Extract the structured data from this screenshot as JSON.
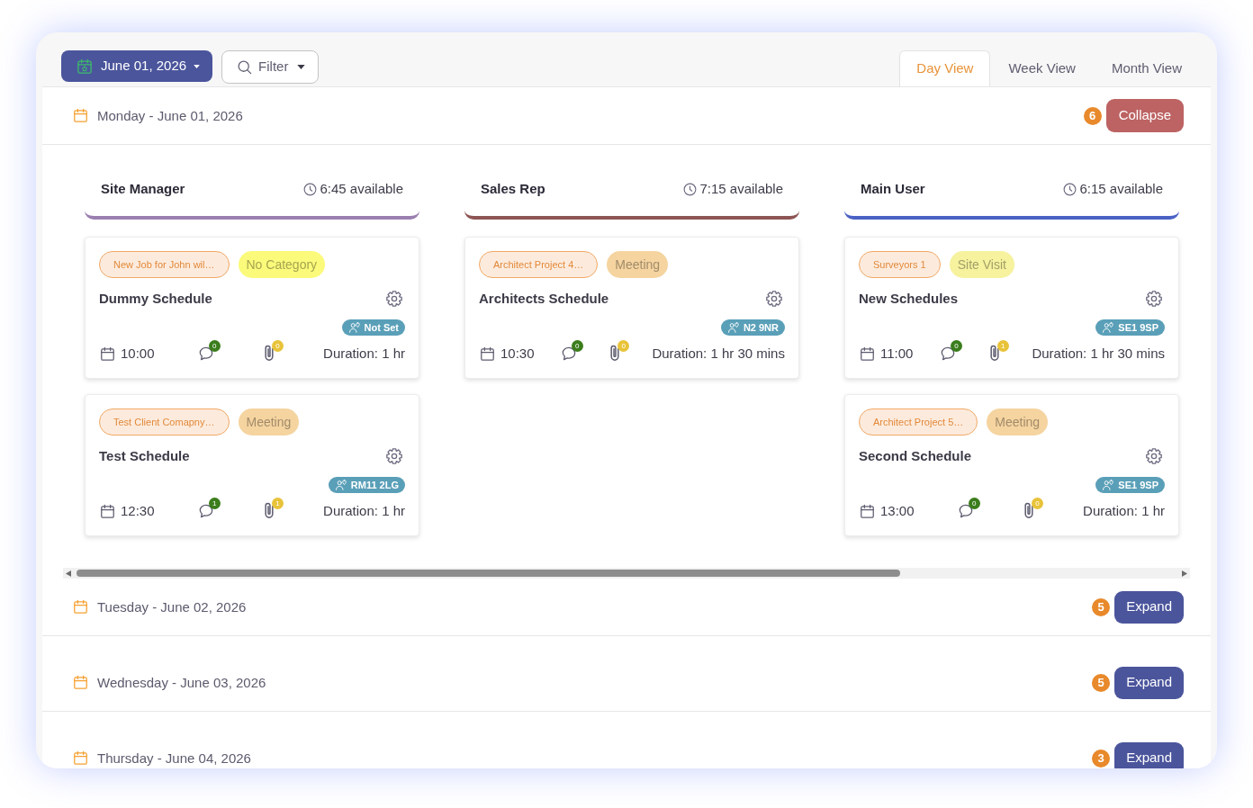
{
  "toolbar": {
    "date_button": "June 01, 2026",
    "filter_button": "Filter"
  },
  "view_tabs": [
    {
      "label": "Day View",
      "selected": true
    },
    {
      "label": "Week View",
      "selected": false
    },
    {
      "label": "Month View",
      "selected": false
    }
  ],
  "days": [
    {
      "label": "Monday - June 01, 2026",
      "count": "6",
      "toggle": "Collapse",
      "expanded": true,
      "staff": [
        {
          "name": "Site Manager",
          "available": "6:45 available",
          "color": "#9b7fb0",
          "schedules": [
            {
              "job": "New Job for John wil…",
              "category": {
                "label": "No Category",
                "color": "#fbfa7a"
              },
              "title": "Dummy Schedule",
              "location": "Not Set",
              "time": "10:00",
              "comments": "0",
              "attachments": "0",
              "duration": "Duration: 1 hr"
            },
            {
              "job": "Test Client Comapny…",
              "category": {
                "label": "Meeting",
                "color": "#f5d4a0"
              },
              "title": "Test Schedule",
              "location": "RM11 2LG",
              "time": "12:30",
              "comments": "1",
              "attachments": "1",
              "duration": "Duration: 1 hr"
            }
          ]
        },
        {
          "name": "Sales Rep",
          "available": "7:15 available",
          "color": "#8e5555",
          "schedules": [
            {
              "job": "Architect Project 4…",
              "category": {
                "label": "Meeting",
                "color": "#f5d4a0"
              },
              "title": "Architects Schedule",
              "location": "N2 9NR",
              "time": "10:30",
              "comments": "0",
              "attachments": "0",
              "duration": "Duration: 1 hr 30 mins"
            }
          ]
        },
        {
          "name": "Main User",
          "available": "6:15 available",
          "color": "#4a62c4",
          "schedules": [
            {
              "job": "Surveyors 1",
              "category": {
                "label": "Site Visit",
                "color": "#f6f29e"
              },
              "title": "New Schedules",
              "location": "SE1 9SP",
              "time": "11:00",
              "comments": "0",
              "attachments": "1",
              "duration": "Duration: 1 hr 30 mins"
            },
            {
              "job": "Architect Project 5…",
              "category": {
                "label": "Meeting",
                "color": "#f5d4a0"
              },
              "title": "Second Schedule",
              "location": "SE1 9SP",
              "time": "13:00",
              "comments": "0",
              "attachments": "0",
              "duration": "Duration: 1 hr"
            }
          ]
        }
      ]
    },
    {
      "label": "Tuesday - June 02, 2026",
      "count": "5",
      "toggle": "Expand",
      "expanded": false
    },
    {
      "label": "Wednesday - June 03, 2026",
      "count": "5",
      "toggle": "Expand",
      "expanded": false
    },
    {
      "label": "Thursday - June 04, 2026",
      "count": "3",
      "toggle": "Expand",
      "expanded": false
    }
  ]
}
